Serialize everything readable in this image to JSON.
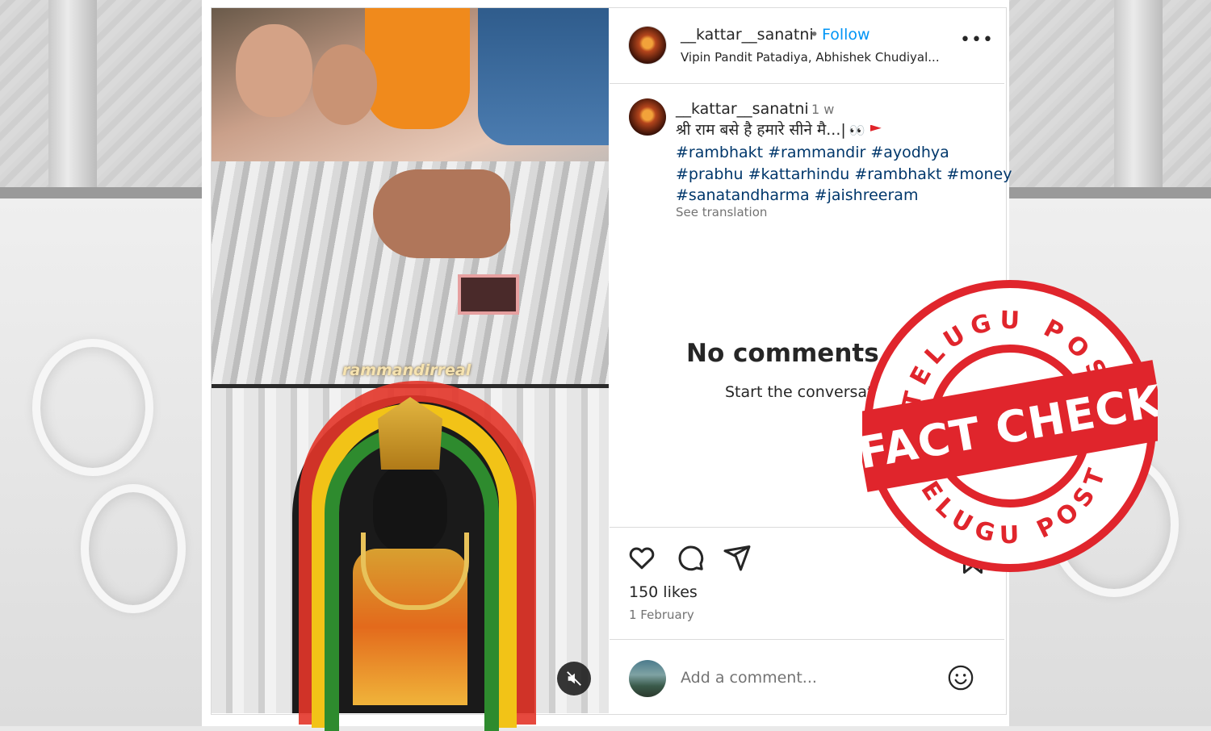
{
  "post": {
    "header": {
      "username": "__kattar__sanatni",
      "separator": "•",
      "follow_label": "Follow",
      "subtitle": "Vipin Pandit Patadiya, Abhishek Chudiyal..."
    },
    "caption": {
      "username": "__kattar__sanatni",
      "time": "1 w",
      "text": "श्री राम बसे है हमारे सीने मै...|",
      "hashtags": [
        "#rambhakt",
        "#rammandir",
        "#ayodhya",
        "#prabhu",
        "#kattarhindu",
        "#rambhakt",
        "#money",
        "#sanatandharma",
        "#jaishreeram"
      ],
      "see_translation": "See translation"
    },
    "comments": {
      "empty_title": "No comments y",
      "empty_subtitle": "Start the conversati"
    },
    "likes": "150 likes",
    "date": "1 February",
    "add_comment_placeholder": "Add a comment..."
  },
  "media": {
    "watermark": "rammandirreal",
    "mute_icon": "speaker-muted-icon"
  },
  "stamp": {
    "top_text": "TELUGU POST",
    "main_text": "FACT CHECK",
    "bottom_text": "TELUGU POST",
    "color": "#e0252c"
  },
  "colors": {
    "follow_blue": "#0095f6",
    "hashtag_blue": "#00376b",
    "muted_gray": "#737373",
    "text": "#262626"
  }
}
